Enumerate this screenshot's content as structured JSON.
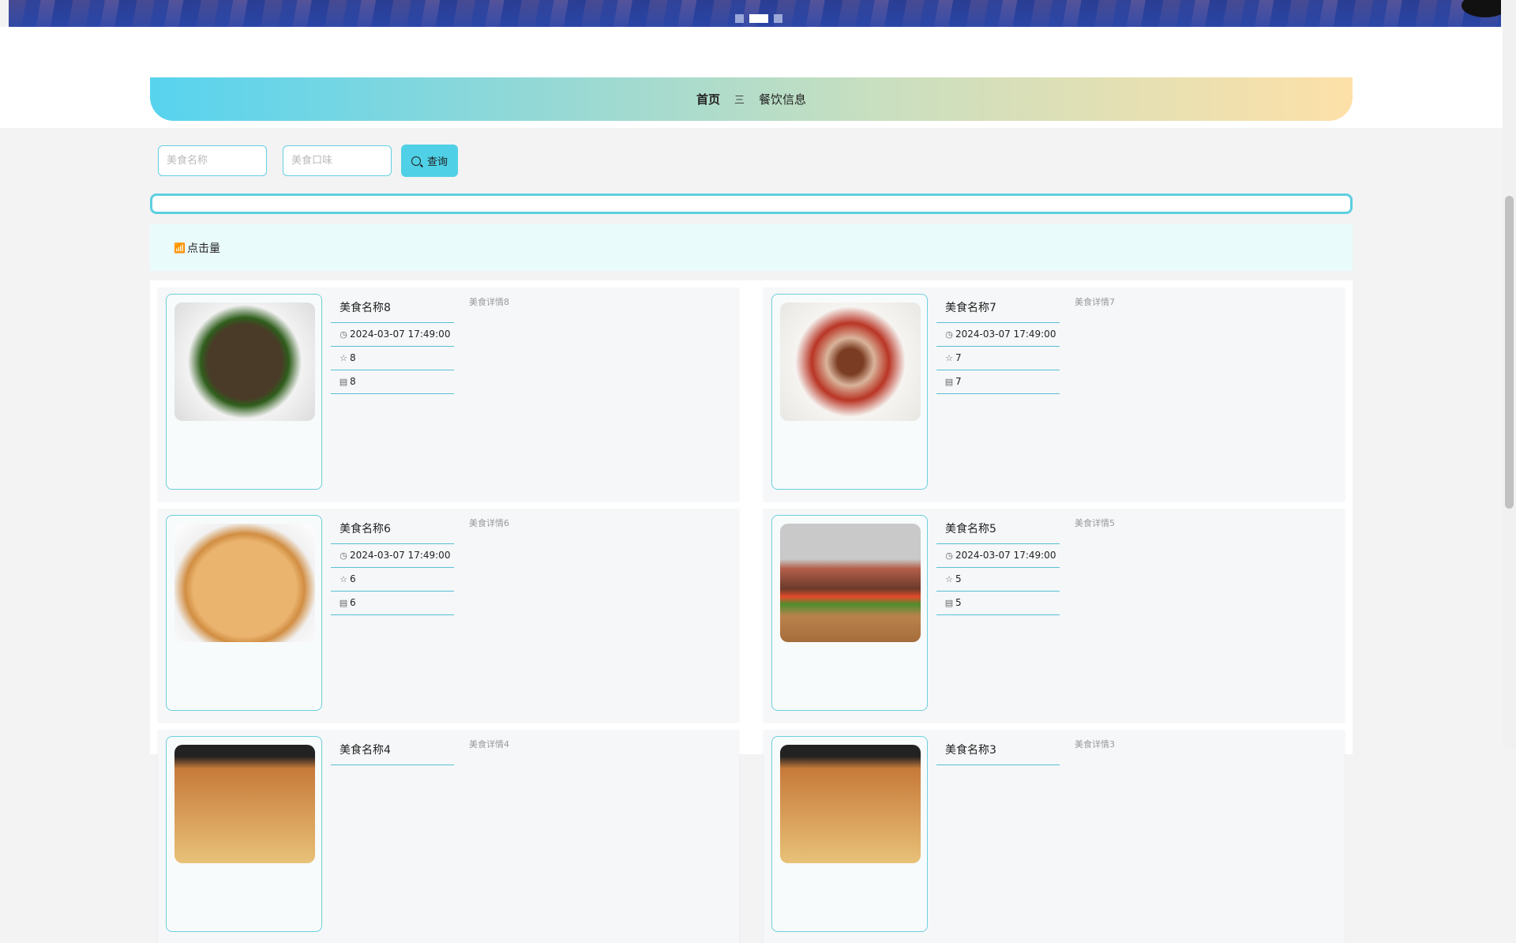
{
  "carousel": {
    "dots": 3,
    "active_index": 1
  },
  "nav": {
    "home": "首页",
    "separator": "三",
    "current": "餐饮信息"
  },
  "search": {
    "name_placeholder": "美食名称",
    "taste_placeholder": "美食口味",
    "button_label": "查询"
  },
  "sort": {
    "label": "点击量"
  },
  "items": [
    {
      "name": "美食名称8",
      "time": "2024-03-07 17:49:00",
      "favorites": "8",
      "clicks": "8",
      "detail": "美食详情8"
    },
    {
      "name": "美食名称7",
      "time": "2024-03-07 17:49:00",
      "favorites": "7",
      "clicks": "7",
      "detail": "美食详情7"
    },
    {
      "name": "美食名称6",
      "time": "2024-03-07 17:49:00",
      "favorites": "6",
      "clicks": "6",
      "detail": "美食详情6"
    },
    {
      "name": "美食名称5",
      "time": "2024-03-07 17:49:00",
      "favorites": "5",
      "clicks": "5",
      "detail": "美食详情5"
    },
    {
      "name": "美食名称4",
      "detail": "美食详情4"
    },
    {
      "name": "美食名称3",
      "detail": "美食详情3"
    }
  ]
}
